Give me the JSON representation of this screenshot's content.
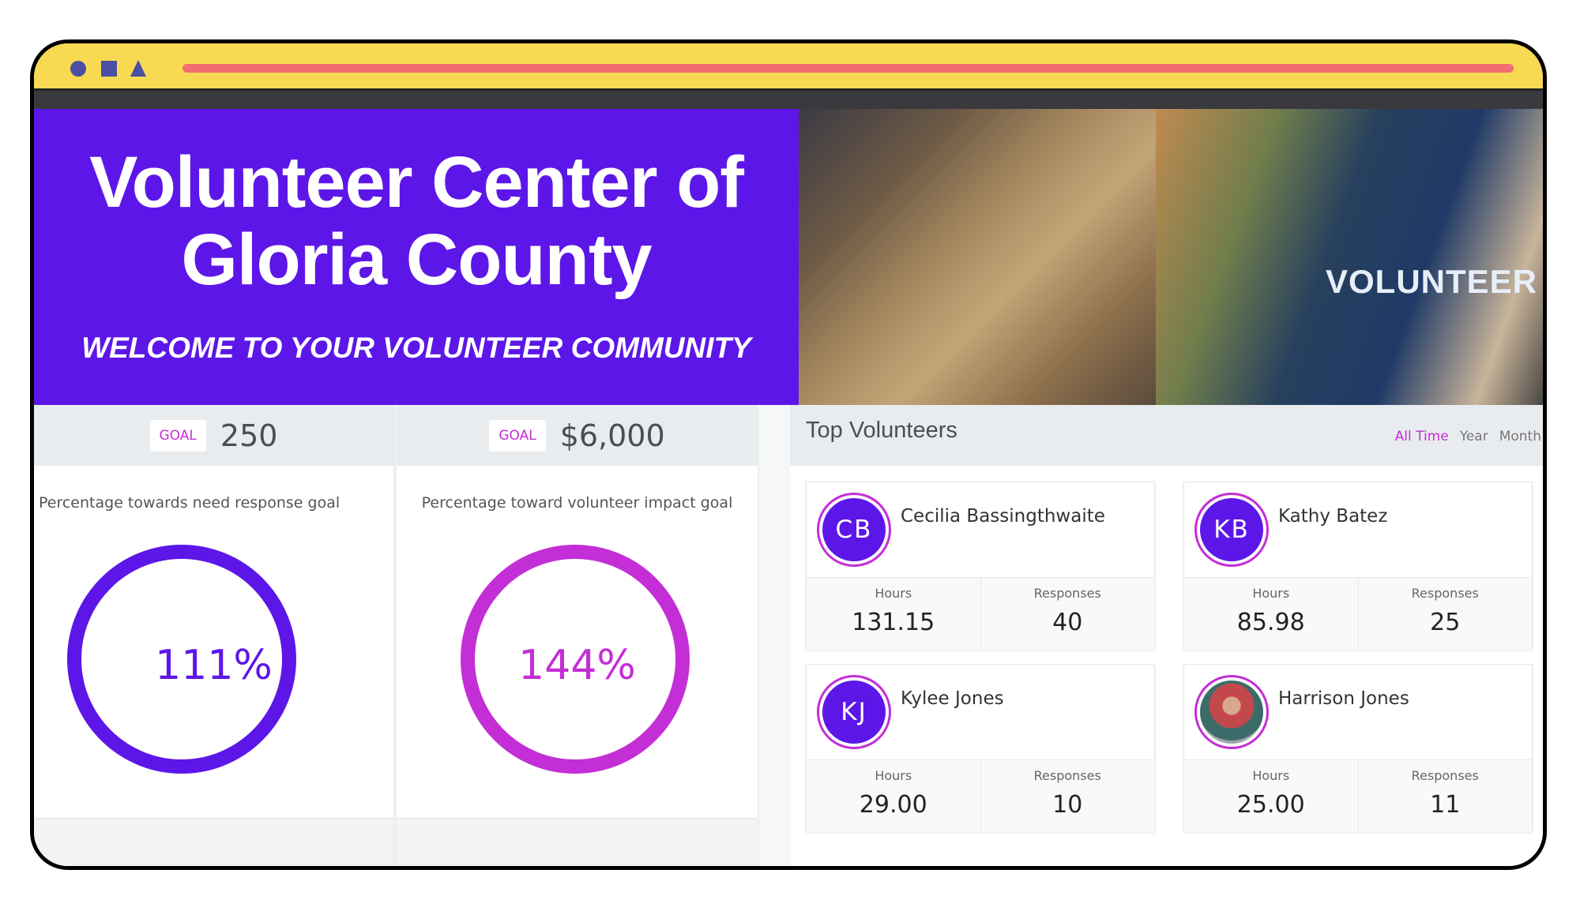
{
  "banner": {
    "title_line1": "Volunteer Center of",
    "title_line2": "Gloria County",
    "subtitle": "WELCOME TO YOUR VOLUNTEER COMMUNITY",
    "photo_text": "VOLUNTEER"
  },
  "colors": {
    "primary": "#5c17e8",
    "accent": "#c42ed6",
    "titlebar": "#f8da52",
    "urlbar": "#f26d6d"
  },
  "goals": [
    {
      "tag": "GOAL",
      "value": "250",
      "description": "Percentage towards need response goal",
      "percent_label": "111%",
      "percent": 111,
      "color": "#5c17e8"
    },
    {
      "tag": "GOAL",
      "value": "$6,000",
      "description": "Percentage toward volunteer impact goal",
      "percent_label": "144%",
      "percent": 144,
      "color": "#c42ed6"
    }
  ],
  "top_volunteers": {
    "title": "Top Volunteers",
    "filters": [
      "All Time",
      "Year",
      "Month"
    ],
    "active_filter": "All Time",
    "hours_label": "Hours",
    "responses_label": "Responses",
    "items": [
      {
        "initials": "CB",
        "name": "Cecilia Bassingthwaite",
        "hours": "131.15",
        "responses": "40"
      },
      {
        "initials": "KB",
        "name": "Kathy Batez",
        "hours": "85.98",
        "responses": "25"
      },
      {
        "initials": "KJ",
        "name": "Kylee Jones",
        "hours": "29.00",
        "responses": "10"
      },
      {
        "initials": "",
        "name": "Harrison Jones",
        "hours": "25.00",
        "responses": "11"
      }
    ]
  }
}
